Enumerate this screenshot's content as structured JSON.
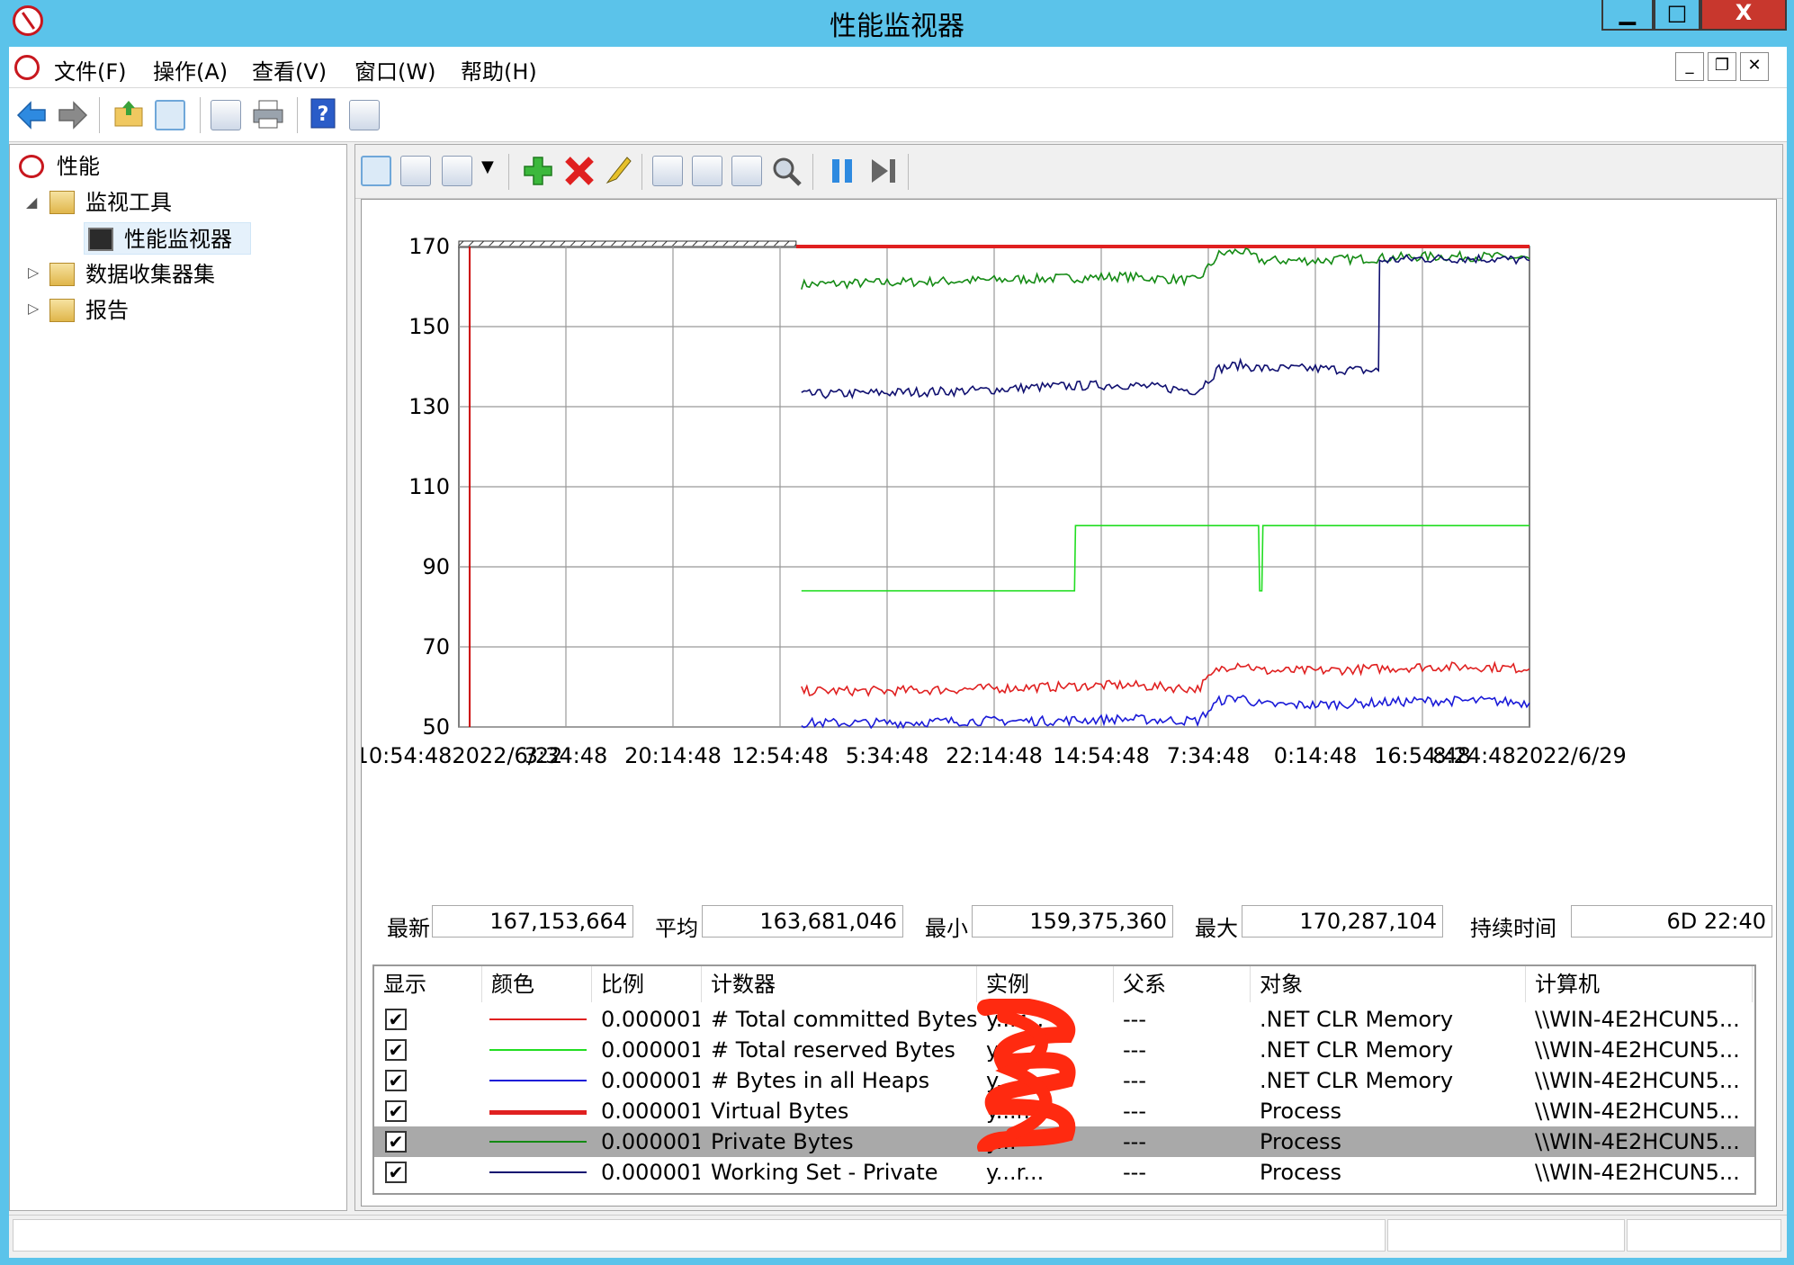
{
  "window": {
    "title": "性能监视器"
  },
  "menubar": {
    "items": [
      "文件(F)",
      "操作(A)",
      "查看(V)",
      "窗口(W)",
      "帮助(H)"
    ]
  },
  "toolbar": {
    "icons": [
      "back-arrow-icon",
      "forward-arrow-icon",
      "folder-up-icon",
      "show-hide-tree-icon",
      "properties-icon",
      "print-icon",
      "help-icon",
      "action-pane-icon"
    ]
  },
  "nav_tree": {
    "root": "性能",
    "items": [
      {
        "label": "监视工具",
        "expanded": true
      },
      {
        "label": "性能监视器",
        "selected": true
      },
      {
        "label": "数据收集器集",
        "expanded": false
      },
      {
        "label": "报告",
        "expanded": false
      }
    ]
  },
  "graph_toolbar": {
    "icons": [
      "view-graph-icon",
      "view-histogram-icon",
      "change-graph-type-icon",
      "dropdown-arrow-icon",
      "add-counter-icon",
      "delete-counter-icon",
      "highlight-icon",
      "copy-properties-icon",
      "paste-counter-list-icon",
      "properties-icon",
      "zoom-icon",
      "freeze-display-icon",
      "update-data-icon"
    ]
  },
  "stats": {
    "latest_label": "最新",
    "latest_value": "167,153,664",
    "average_label": "平均",
    "average_value": "163,681,046",
    "min_label": "最小",
    "min_value": "159,375,360",
    "max_label": "最大",
    "max_value": "170,287,104",
    "duration_label": "持续时间",
    "duration_value": "6D 22:40"
  },
  "legend_table": {
    "headers": [
      "显示",
      "颜色",
      "比例",
      "计数器",
      "实例",
      "父系",
      "对象",
      "计算机"
    ],
    "rows": [
      {
        "scale": "0.000001",
        "counter": "# Total committed Bytes",
        "instance": "y...r...",
        "parent": "---",
        "object": ".NET CLR Memory",
        "computer": "\\\\WIN-4E2HCUN5...",
        "color": "#e02020",
        "thick": false,
        "selected": false
      },
      {
        "scale": "0.000001",
        "counter": "# Total reserved Bytes",
        "instance": "y...",
        "parent": "---",
        "object": ".NET CLR Memory",
        "computer": "\\\\WIN-4E2HCUN5...",
        "color": "#22dd22",
        "thick": false,
        "selected": false
      },
      {
        "scale": "0.000001",
        "counter": "# Bytes in all Heaps",
        "instance": "y...r...",
        "parent": "---",
        "object": ".NET CLR Memory",
        "computer": "\\\\WIN-4E2HCUN5...",
        "color": "#1a1ad8",
        "thick": false,
        "selected": false
      },
      {
        "scale": "0.000001",
        "counter": "Virtual Bytes",
        "instance": "y...r...",
        "parent": "---",
        "object": "Process",
        "computer": "\\\\WIN-4E2HCUN5...",
        "color": "#e02020",
        "thick": true,
        "selected": false
      },
      {
        "scale": "0.000001",
        "counter": "Private Bytes",
        "instance": "y...",
        "parent": "---",
        "object": "Process",
        "computer": "\\\\WIN-4E2HCUN5...",
        "color": "#138a13",
        "thick": false,
        "selected": true
      },
      {
        "scale": "0.000001",
        "counter": "Working Set - Private",
        "instance": "y...r...",
        "parent": "---",
        "object": "Process",
        "computer": "\\\\WIN-4E2HCUN5...",
        "color": "#101070",
        "thick": false,
        "selected": false
      }
    ]
  },
  "chart_data": {
    "type": "line",
    "title": "",
    "xlabel": "",
    "ylabel": "",
    "ylim": [
      50,
      170
    ],
    "y_ticks": [
      50,
      70,
      90,
      110,
      130,
      150,
      170
    ],
    "x_tick_labels": [
      "10:54:482022/6/22",
      "3:34:48",
      "20:14:48",
      "12:54:48",
      "5:34:48",
      "22:14:48",
      "14:54:48",
      "7:34:48",
      "0:14:48",
      "16:54:48",
      "8:24:482022/6/29"
    ],
    "grid": true,
    "x_range": [
      0,
      10
    ],
    "series": [
      {
        "name": "Virtual Bytes",
        "color": "#e02020",
        "thick": true,
        "x": [
          3.15,
          10
        ],
        "y": [
          170,
          170
        ]
      },
      {
        "name": "# Total reserved Bytes",
        "color": "#22dd22",
        "thick": false,
        "x": [
          3.2,
          5.75,
          5.76,
          7.47,
          7.48,
          7.5,
          7.51,
          10
        ],
        "y": [
          84,
          84,
          100.3,
          100.3,
          84,
          84,
          100.3,
          100.3
        ]
      },
      {
        "name": "Private Bytes",
        "color": "#138a13",
        "thick": false,
        "x": [
          3.2,
          4.0,
          4.8,
          5.5,
          6.2,
          6.9,
          7.1,
          7.3,
          7.5,
          8.0,
          8.5,
          9.0,
          9.6,
          10
        ],
        "y": [
          160.5,
          161,
          161.5,
          162,
          162.5,
          161.5,
          168,
          169,
          166.5,
          166.5,
          167,
          167.5,
          167.5,
          167
        ]
      },
      {
        "name": "Working Set - Private",
        "color": "#101070",
        "thick": false,
        "x": [
          3.2,
          4.0,
          4.8,
          5.5,
          6.2,
          6.9,
          7.1,
          7.3,
          7.5,
          8.0,
          8.5,
          8.59,
          8.6,
          9.0,
          9.6,
          10
        ],
        "y": [
          133,
          133.5,
          134,
          135,
          135.5,
          134,
          139.5,
          140.5,
          139.5,
          139.5,
          139,
          139,
          166.5,
          167,
          167,
          166.5
        ]
      },
      {
        "name": "# Total committed Bytes",
        "color": "#e02020",
        "thick": false,
        "x": [
          3.2,
          4.0,
          4.8,
          5.5,
          6.2,
          6.9,
          7.1,
          7.3,
          7.5,
          8.0,
          8.5,
          9.0,
          9.6,
          10
        ],
        "y": [
          59,
          59,
          59.5,
          60,
          60.5,
          59.5,
          64.5,
          66,
          64,
          64,
          64.5,
          65,
          65,
          64.5
        ]
      },
      {
        "name": "# Bytes in all Heaps",
        "color": "#1a1ad8",
        "thick": false,
        "x": [
          3.2,
          4.0,
          4.8,
          5.5,
          6.2,
          6.9,
          7.1,
          7.3,
          7.5,
          8.0,
          8.5,
          9.0,
          9.6,
          10
        ],
        "y": [
          51,
          51,
          51.5,
          51.5,
          52,
          51.5,
          56.5,
          57.5,
          55.5,
          55.5,
          56,
          56.5,
          56.5,
          56
        ]
      }
    ]
  }
}
